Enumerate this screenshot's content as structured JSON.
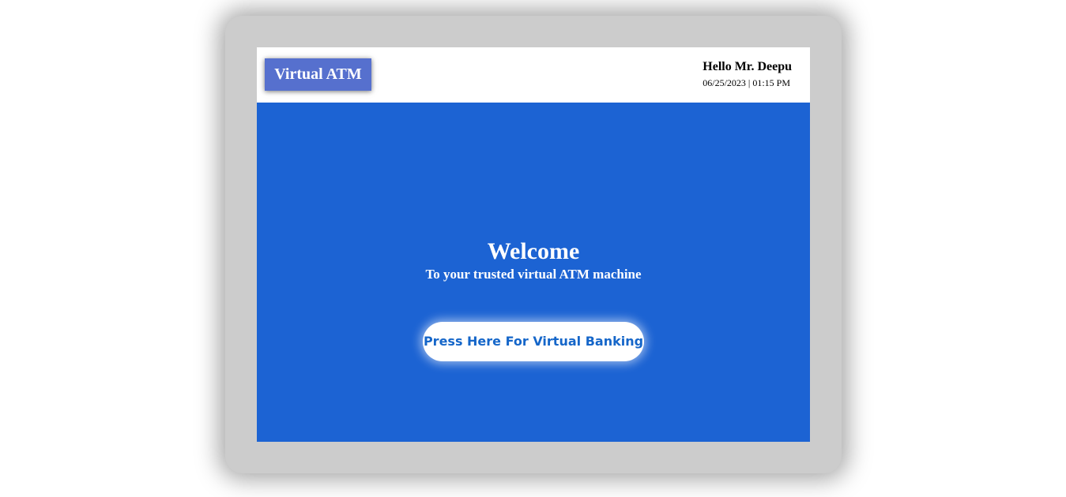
{
  "header": {
    "brand_label": "Virtual ATM",
    "greeting": "Hello Mr. Deepu",
    "datetime": "06/25/2023 | 01:15 PM"
  },
  "main": {
    "welcome_title": "Welcome",
    "welcome_subtitle": "To your trusted virtual ATM machine",
    "start_button_label": "Press Here For Virtual Banking"
  },
  "colors": {
    "screen_background": "#1c63d3",
    "brand_background": "#5670ce",
    "frame": "#cccccc",
    "button_text": "#1566c9"
  }
}
